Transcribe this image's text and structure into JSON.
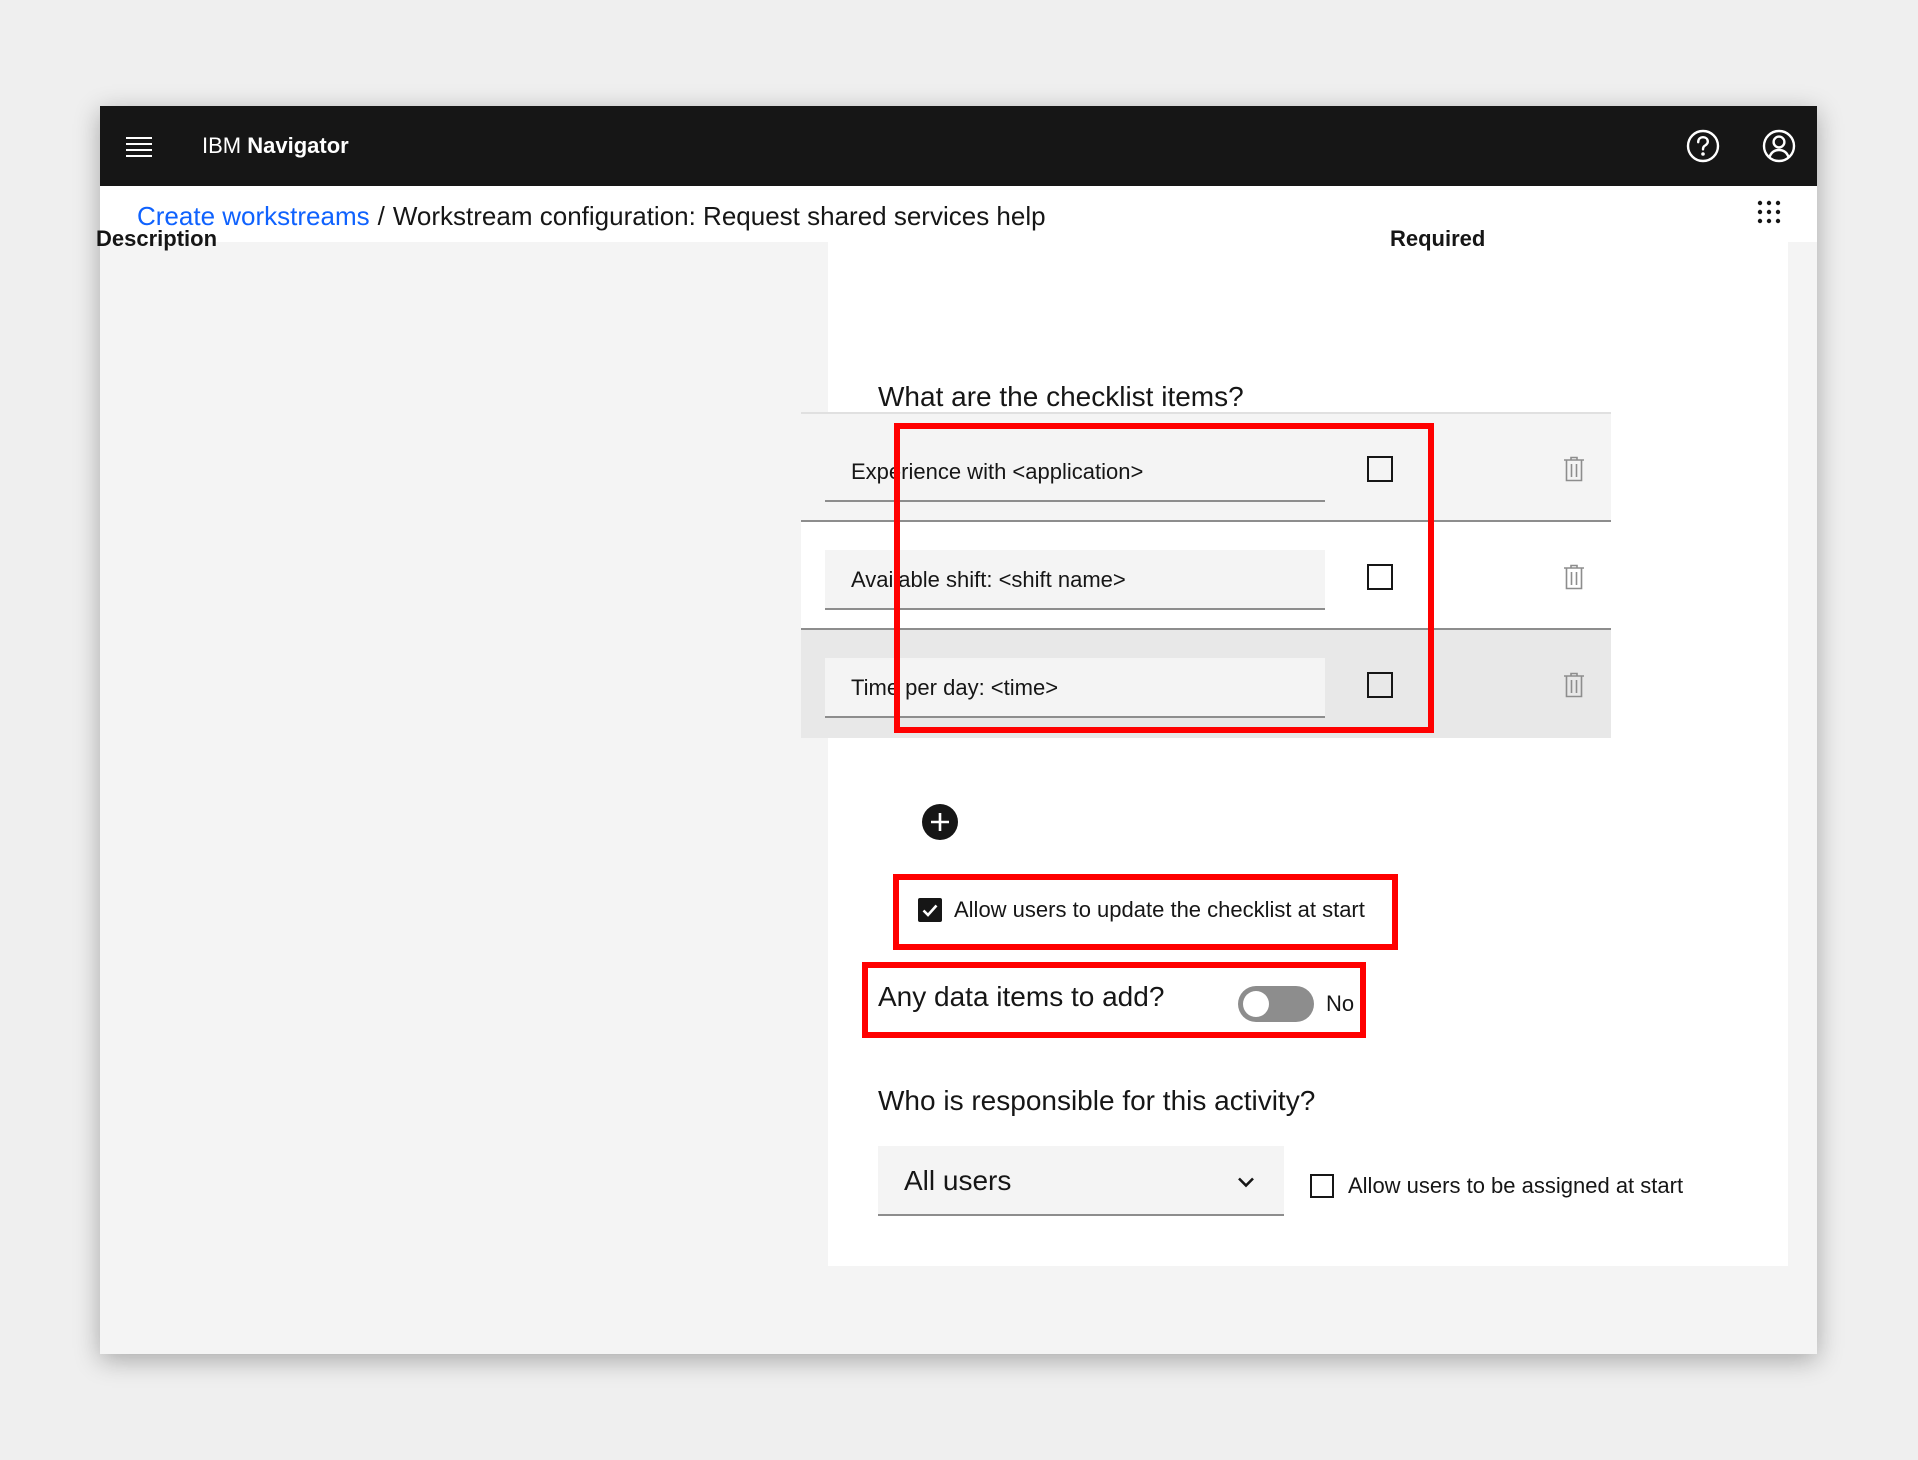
{
  "topbar": {
    "brand_prefix": "IBM",
    "brand_name": "Navigator",
    "menu_icon": "hamburger-menu-icon",
    "help_icon": "help-icon",
    "user_icon": "user-avatar-icon"
  },
  "breadcrumb": {
    "link": "Create workstreams",
    "separator": "/",
    "current": "Workstream configuration: Request shared services help",
    "app_switcher_icon": "app-switcher-icon"
  },
  "checklist": {
    "question": "What are the checklist items?",
    "columns": {
      "description": "Description",
      "required": "Required"
    },
    "items": [
      {
        "description": "Experience with <application>",
        "required": false
      },
      {
        "description": "Available shift: <shift name>",
        "required": false
      },
      {
        "description": "Time per day: <time>",
        "required": false
      }
    ],
    "add_icon": "add-circle-icon",
    "delete_icon": "trash-icon",
    "allow_update": {
      "label": "Allow users to update the checklist at start",
      "checked": true
    }
  },
  "data_items": {
    "question": "Any data items to add?",
    "toggle_state": "No",
    "enabled": false
  },
  "responsible": {
    "question": "Who is responsible for this activity?",
    "selected": "All users",
    "allow_assign": {
      "label": "Allow users to be assigned at start",
      "checked": false
    }
  },
  "colors": {
    "topbar_bg": "#161616",
    "link": "#0f62fe",
    "highlight": "#ff0000",
    "page_bg": "#f4f4f4"
  }
}
